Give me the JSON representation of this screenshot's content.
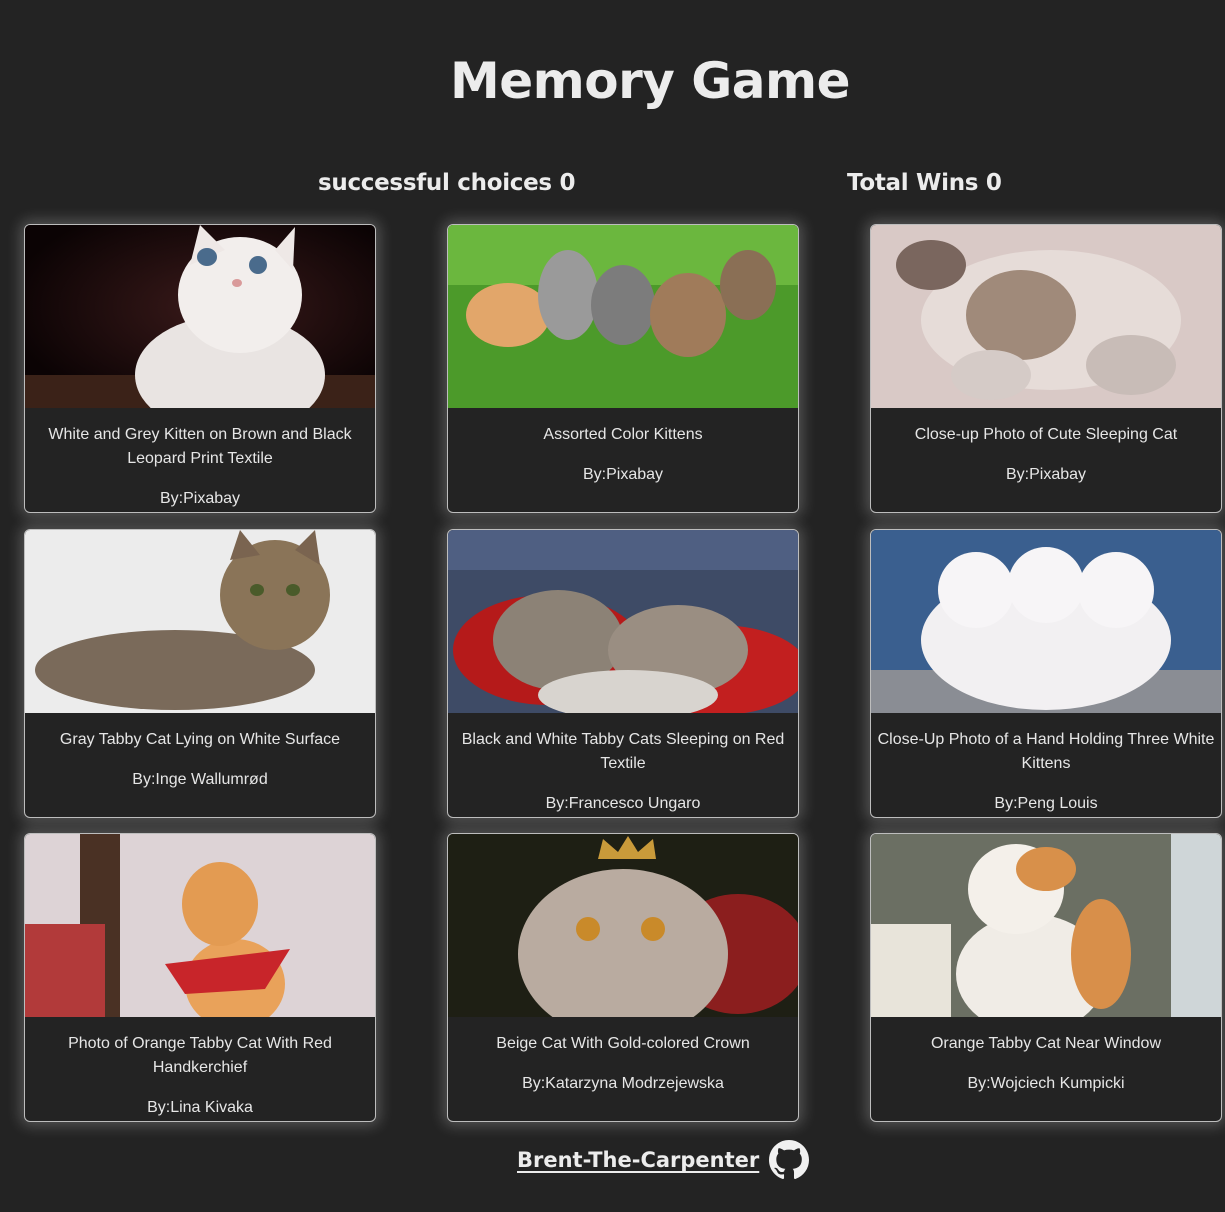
{
  "header": {
    "title": "Memory Game"
  },
  "scores": {
    "successful_label": "successful choices 0",
    "wins_label": "Total Wins 0"
  },
  "cards": [
    {
      "title": "White and Grey Kitten on Brown and Black Leopard Print Textile",
      "author": "By:Pixabay",
      "image": "white-grey-kitten"
    },
    {
      "title": "Assorted Color Kittens",
      "author": "By:Pixabay",
      "image": "kittens-grass"
    },
    {
      "title": "Close-up Photo of Cute Sleeping Cat",
      "author": "By:Pixabay",
      "image": "sleeping-cat"
    },
    {
      "title": "Gray Tabby Cat Lying on White Surface",
      "author": "By:Inge Wallumrød",
      "image": "gray-tabby"
    },
    {
      "title": "Black and White Tabby Cats Sleeping on Red Textile",
      "author": "By:Francesco Ungaro",
      "image": "tabby-red-textile"
    },
    {
      "title": "Close-Up Photo of a Hand Holding Three White Kittens",
      "author": "By:Peng Louis",
      "image": "three-white-kittens"
    },
    {
      "title": "Photo of Orange Tabby Cat With Red Handkerchief",
      "author": "By:Lina Kivaka",
      "image": "orange-tabby-handkerchief"
    },
    {
      "title": "Beige Cat With Gold-colored Crown",
      "author": "By:Katarzyna Modrzejewska",
      "image": "beige-cat-crown"
    },
    {
      "title": "Orange Tabby Cat Near Window",
      "author": "By:Wojciech Kumpicki",
      "image": "orange-tabby-window"
    }
  ],
  "footer": {
    "link_text": "Brent-The-Carpenter",
    "icon": "github-icon"
  },
  "colors": {
    "background": "#232323",
    "text": "#ececec",
    "card_border": "#bdbdbd"
  }
}
